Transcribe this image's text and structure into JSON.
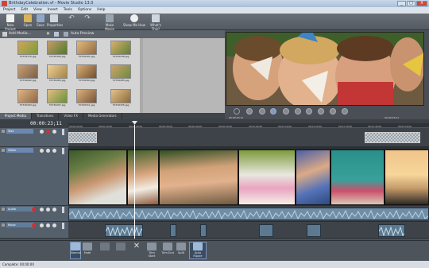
{
  "window": {
    "title": "BirthdayCelebration.vf - Movie Studio 13.0",
    "controls": {
      "minimize": "_",
      "maximize": "□",
      "close": "X"
    }
  },
  "menu": [
    "Project",
    "Edit",
    "View",
    "Insert",
    "Tools",
    "Options",
    "Help"
  ],
  "toolbar": {
    "buttons": [
      {
        "label": "New Project",
        "icon": "new-project-icon"
      },
      {
        "label": "Open",
        "icon": "folder-open-icon"
      },
      {
        "label": "Save",
        "icon": "save-icon"
      },
      {
        "label": "Properties",
        "icon": "properties-icon"
      },
      {
        "label": "",
        "icon": "undo-icon"
      },
      {
        "label": "",
        "icon": "redo-icon"
      },
      {
        "label": "Make Movie",
        "icon": "make-movie-icon"
      },
      {
        "label": "Show Me How",
        "icon": "show-me-how-icon"
      },
      {
        "label": "What's This?",
        "icon": "whats-this-icon"
      }
    ]
  },
  "media": {
    "toolbar": {
      "add_media": "Add Media...",
      "auto_preview": "Auto Preview"
    },
    "files": [
      "70730170.jpg",
      "70730199.jpg",
      "70730201.jpg",
      "70730238.jpg",
      "70730262.jpg",
      "70730265.jpg",
      "70730264.jpg",
      "70730285.jpg",
      "70730293.jpg",
      "70730297.jpg",
      "70730311.jpg",
      "70730325.jpg"
    ],
    "tabs": [
      "Project Media",
      "Transitions",
      "Video FX",
      "Media Generators"
    ]
  },
  "preview": {
    "in_time": "00:00:23;11",
    "out_time": "00:00:23;11"
  },
  "timeline": {
    "timecode": "00:00:23;11",
    "ruler_labels": [
      "00:00:00;00",
      "00:00:10;00",
      "00:00:20;00",
      "00:00:30;00",
      "00:00:40;00",
      "00:00:50;00",
      "00:01:00;00",
      "00:01:10;00",
      "00:01:20;00",
      "00:01:30;00",
      "00:01:40;00",
      "00:01:50;00"
    ],
    "tracks": [
      {
        "name": "Text",
        "kind": "text"
      },
      {
        "name": "Video",
        "kind": "video"
      },
      {
        "name": "Audio",
        "kind": "audio"
      },
      {
        "name": "Music",
        "kind": "music"
      }
    ]
  },
  "bottom": {
    "buttons": [
      "Normal",
      "Fade",
      "",
      "",
      "",
      "Trim Start",
      "Trim End",
      "Split",
      "Auto Ripple"
    ]
  },
  "status": {
    "text": "Complete: 00:00:00"
  },
  "colors": {
    "accent": "#6b88b0",
    "audio": "#5b7a92",
    "playhead": "#ffffff"
  }
}
